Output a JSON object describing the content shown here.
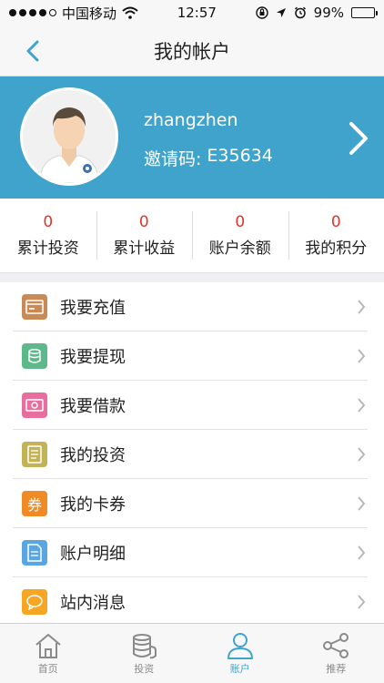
{
  "status_bar": {
    "carrier": "中国移动",
    "time": "12:57",
    "battery_percent": "99%",
    "battery_level": 0.99
  },
  "nav": {
    "title": "我的帐户",
    "back_icon": "chevron-left-icon"
  },
  "profile": {
    "username": "zhangzhen",
    "invite_label": "邀请码:",
    "invite_code": "E35634",
    "colors": {
      "background": "#3fa3cc"
    }
  },
  "stats": [
    {
      "value": "0",
      "label": "累计投资"
    },
    {
      "value": "0",
      "label": "累计收益"
    },
    {
      "value": "0",
      "label": "账户余额"
    },
    {
      "value": "0",
      "label": "我的积分"
    }
  ],
  "menu": [
    {
      "label": "我要充值",
      "icon": "recharge-icon",
      "color": "#c98a55"
    },
    {
      "label": "我要提现",
      "icon": "withdraw-icon",
      "color": "#5db98b"
    },
    {
      "label": "我要借款",
      "icon": "loan-icon",
      "color": "#e86ea0"
    },
    {
      "label": "我的投资",
      "icon": "investment-doc-icon",
      "color": "#c2b356"
    },
    {
      "label": "我的卡券",
      "icon": "coupon-icon",
      "color": "#f08a24",
      "glyph": "券"
    },
    {
      "label": "账户明细",
      "icon": "account-detail-icon",
      "color": "#5aa6e3"
    },
    {
      "label": "站内消息",
      "icon": "message-icon",
      "color": "#f5a623"
    }
  ],
  "tabbar": [
    {
      "label": "首页",
      "icon": "home-icon",
      "active": false
    },
    {
      "label": "投资",
      "icon": "coins-icon",
      "active": false
    },
    {
      "label": "账户",
      "icon": "user-icon",
      "active": true
    },
    {
      "label": "推荐",
      "icon": "share-icon",
      "active": false
    }
  ]
}
